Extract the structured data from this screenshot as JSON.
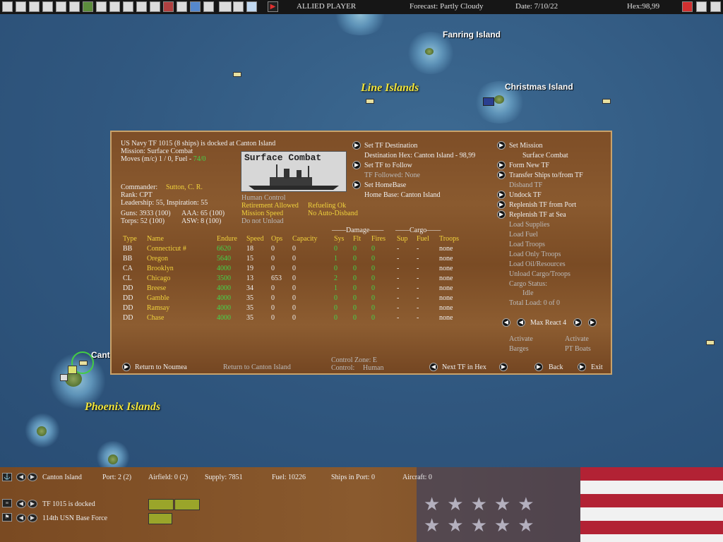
{
  "topbar": {
    "player": "ALLIED PLAYER",
    "forecast": "Forecast: Partly Cloudy",
    "date": "Date: 7/10/22",
    "hex": "Hex:98,99",
    "icons": [
      "menu-icon",
      "report-icon",
      "filter-icon",
      "list-icon",
      "info-icon",
      "star-icon",
      "unit-icon",
      "unit2-icon",
      "flag-icon",
      "plane-icon",
      "ship-icon",
      "map-icon",
      "grid-icon",
      "globe-icon",
      "zoom-icon",
      "op-icon",
      "option-icon",
      "cloud-icon",
      "end-turn-icon"
    ],
    "right_icons": [
      "flag-icon",
      "c-icon",
      "close-icon"
    ]
  },
  "map": {
    "labels": {
      "fanring": "Fanring Island",
      "christmas": "Christmas Island",
      "canton_partial": "Canto"
    },
    "regions": {
      "line": "Line Islands",
      "phoenix": "Phoenix Islands"
    }
  },
  "panel": {
    "tf_title": "US Navy TF 1015 (8 ships) is docked at Canton Island",
    "mission": "Mission: Surface Combat",
    "moves_prefix": "Moves (m/c)  1 / 0, Fuel - ",
    "fuel_value": "74/0",
    "photo_caption": "Surface Combat",
    "commander_label": "Commander:",
    "commander_name": "Sutton, C. R.",
    "rank": "Rank: CPT",
    "leadership": "Leadership: 55, Inspiration: 55",
    "guns": "Guns: 3933 (100)",
    "aaa": "AAA: 65 (100)",
    "torps": "Torps: 52 (100)",
    "asw": "ASW: 8 (100)",
    "human_control": "Human Control",
    "retirement": "Retirement Allowed",
    "refueling": "Refueling Ok",
    "mission_speed": "Mission Speed",
    "auto_disband": "No Auto-Disband",
    "do_not_unload": "Do not Unload",
    "set_dest": "Set TF Destination",
    "dest_hex": "Destination Hex: Canton Island - 98,99",
    "set_follow": "Set TF to Follow",
    "tf_followed": "TF Followed: None",
    "set_home": "Set HomeBase",
    "home_base": "Home Base: Canton Island",
    "set_mission": "Set Mission",
    "mission_value": "Surface Combat",
    "form_new": "Form New TF",
    "transfer": "Transfer Ships to/from TF",
    "disband": "Disband TF",
    "undock": "Undock TF",
    "replenish_port": "Replenish TF from Port",
    "replenish_sea": "Replenish TF at Sea",
    "load_supplies": "Load Supplies",
    "load_fuel": "Load Fuel",
    "load_troops": "Load Troops",
    "load_only_troops": "Load Only Troops",
    "load_oil": "Load Oil/Resources",
    "unload": "Unload Cargo/Troops",
    "cargo_status": "Cargo Status:",
    "cargo_idle": "Idle",
    "total_load": "Total Load: 0 of 0",
    "max_react": "Max React 4",
    "activate1": "Activate",
    "barges": "Barges",
    "activate2": "Activate",
    "pt_boats": "PT Boats",
    "return_noumea": "Return to Noumea",
    "return_canton": "Return to Canton Island",
    "control_zone": "Control Zone: E",
    "control": "Control:",
    "control_value": "Human",
    "next_tf": "Next TF in Hex",
    "back": "Back",
    "exit": "Exit",
    "group_damage": "Damage",
    "group_cargo": "Cargo",
    "headers": [
      "Type",
      "Name",
      "Endure",
      "Speed",
      "Ops",
      "Capacity",
      "Sys",
      "Flt",
      "Fires",
      "Sup",
      "Fuel",
      "Troops"
    ],
    "ships": [
      {
        "type": "BB",
        "name": "Connecticut #",
        "endure": "6620",
        "speed": "18",
        "ops": "0",
        "capacity": "0",
        "sys": "0",
        "flt": "0",
        "fires": "0",
        "sup": "-",
        "fuel": "-",
        "troops": "none"
      },
      {
        "type": "BB",
        "name": "Oregon",
        "endure": "5640",
        "speed": "15",
        "ops": "0",
        "capacity": "0",
        "sys": "1",
        "flt": "0",
        "fires": "0",
        "sup": "-",
        "fuel": "-",
        "troops": "none"
      },
      {
        "type": "CA",
        "name": "Brooklyn",
        "endure": "4000",
        "speed": "19",
        "ops": "0",
        "capacity": "0",
        "sys": "0",
        "flt": "0",
        "fires": "0",
        "sup": "-",
        "fuel": "-",
        "troops": "none"
      },
      {
        "type": "CL",
        "name": "Chicago",
        "endure": "3500",
        "speed": "13",
        "ops": "653",
        "capacity": "0",
        "sys": "2",
        "flt": "0",
        "fires": "0",
        "sup": "-",
        "fuel": "-",
        "troops": "none"
      },
      {
        "type": "DD",
        "name": "Breese",
        "endure": "4000",
        "speed": "34",
        "ops": "0",
        "capacity": "0",
        "sys": "1",
        "flt": "0",
        "fires": "0",
        "sup": "-",
        "fuel": "-",
        "troops": "none"
      },
      {
        "type": "DD",
        "name": "Gamble",
        "endure": "4000",
        "speed": "35",
        "ops": "0",
        "capacity": "0",
        "sys": "0",
        "flt": "0",
        "fires": "0",
        "sup": "-",
        "fuel": "-",
        "troops": "none"
      },
      {
        "type": "DD",
        "name": "Ramsay",
        "endure": "4000",
        "speed": "35",
        "ops": "0",
        "capacity": "0",
        "sys": "0",
        "flt": "0",
        "fires": "0",
        "sup": "-",
        "fuel": "-",
        "troops": "none"
      },
      {
        "type": "DD",
        "name": "Chase",
        "endure": "4000",
        "speed": "35",
        "ops": "0",
        "capacity": "0",
        "sys": "0",
        "flt": "0",
        "fires": "0",
        "sup": "-",
        "fuel": "-",
        "troops": "none"
      }
    ]
  },
  "bottom": {
    "location": "Canton Island",
    "port": "Port: 2 (2)",
    "airfield": "Airfield: 0 (2)",
    "supply": "Supply: 7851",
    "fuel": "Fuel: 10226",
    "ships_in_port": "Ships in Port: 0",
    "aircraft": "Aircraft: 0",
    "tf_status": "TF 1015 is docked",
    "base_force": "114th USN Base Force"
  },
  "colors": {
    "accent_yellow": "#f0d23c",
    "status_green": "#43d64a",
    "panel_wood": "#7e4e27",
    "sea": "#33597f"
  }
}
